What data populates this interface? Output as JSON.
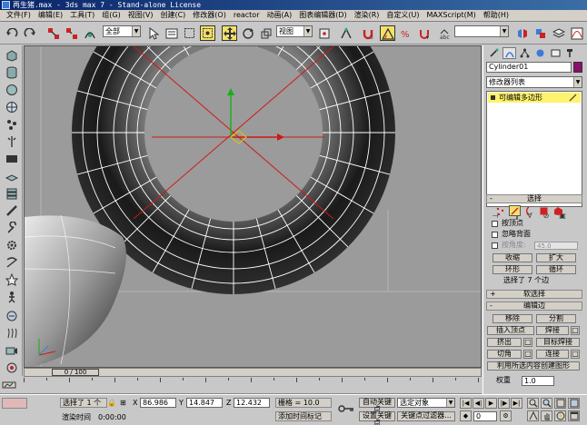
{
  "window": {
    "title": "再生猪.max - 3ds max 7 - Stand-alone License"
  },
  "menu": [
    "文件(F)",
    "编辑(E)",
    "工具(T)",
    "组(G)",
    "视图(V)",
    "创建(C)",
    "修改器(O)",
    "reactor",
    "动画(A)",
    "图表编辑器(D)",
    "渲染(R)",
    "自定义(U)",
    "MAXScript(M)",
    "帮助(H)"
  ],
  "toolbar": {
    "selection_filter": "全部",
    "ref_coord": "视图",
    "named_selection": ""
  },
  "viewport": {
    "label": ""
  },
  "time_slider": {
    "position": "0 / 100"
  },
  "command_panel": {
    "object_name": "Cylinder01",
    "modifier_list": "修改器列表",
    "stack_item": "可编辑多边形",
    "selection_rollout": {
      "title": "选择",
      "by_vertex": "按顶点",
      "ignore_backfacing": "忽略背面",
      "by_angle": "按角度:",
      "angle_value": "45.0",
      "shrink": "收缩",
      "grow": "扩大",
      "ring": "环形",
      "loop": "循环",
      "status": "选择了 7 个边"
    },
    "soft_selection_rollout": {
      "title": "软选择"
    },
    "edit_edges_rollout": {
      "title": "编辑边",
      "remove": "移除",
      "split": "分割",
      "insert_vertex": "插入顶点",
      "weld": "焊接",
      "extrude": "挤出",
      "target_weld": "目标焊接",
      "chamfer": "切角",
      "connect": "连接",
      "create_shape": "利用所选内容创建图形",
      "weight_label": "权重",
      "weight_value": "1.0"
    }
  },
  "status": {
    "selected": "选择了 1 个",
    "x_label": "X",
    "x": "86.986",
    "y_label": "Y",
    "y": "14.847",
    "z_label": "Z",
    "z": "12.432",
    "grid": "栅格 = 10.0",
    "auto_key": "自动关键点",
    "selected_object": "选定对象",
    "set_key": "设置关键点",
    "key_filters": "关键点过滤器...",
    "render_time_label": "渲染时间",
    "render_time": "0:00:00",
    "add_time_tag": "添加时间标记",
    "frame": "0"
  },
  "colors": {
    "accent_yellow": "#f4e06a",
    "object_color": "#8b0f6e",
    "viewport_bg": "#9b9b9b"
  }
}
